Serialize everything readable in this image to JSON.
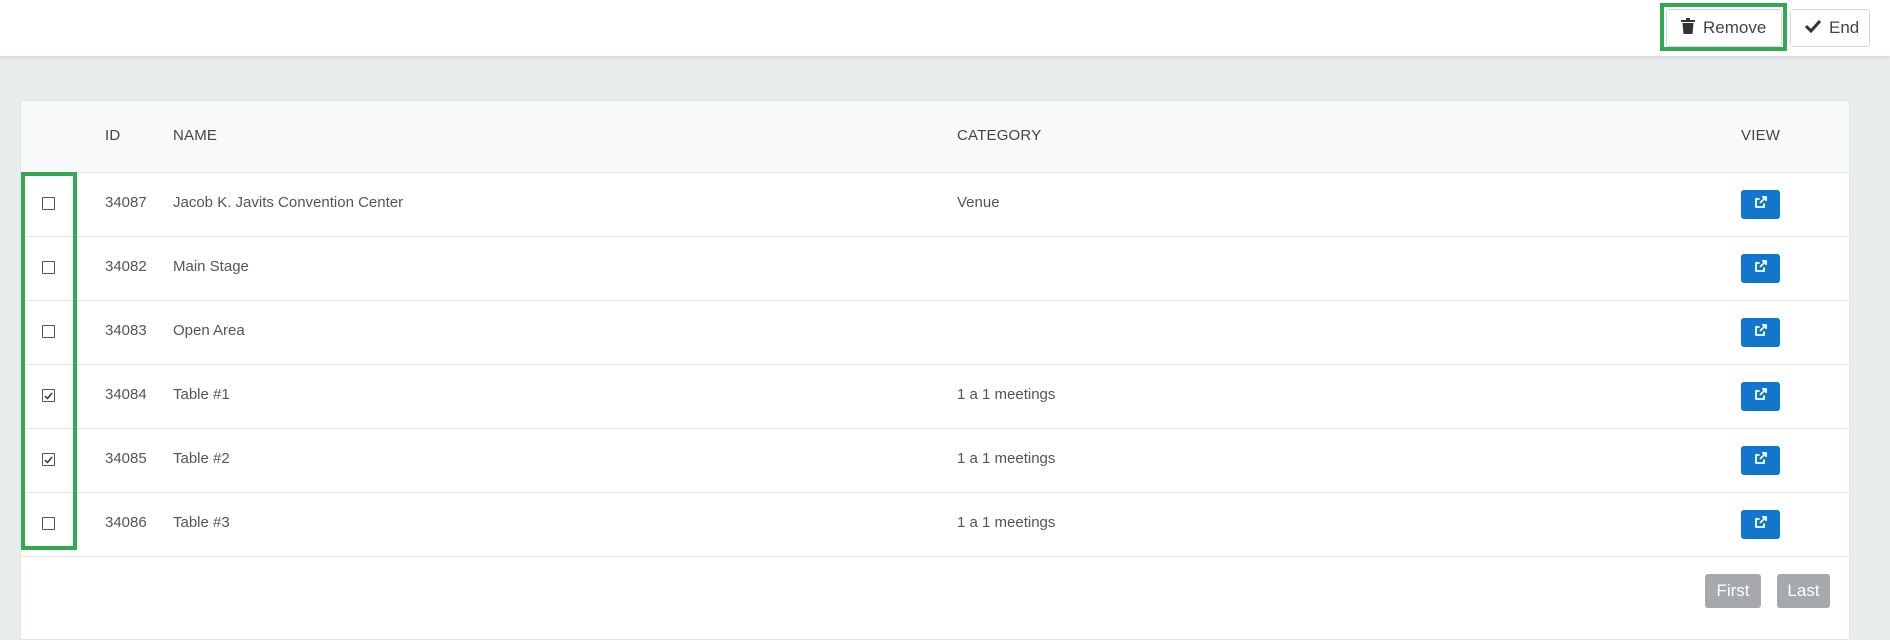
{
  "toolbar": {
    "remove_label": "Remove",
    "end_label": "End"
  },
  "table": {
    "headers": {
      "id": "ID",
      "name": "NAME",
      "category": "CATEGORY",
      "view": "VIEW"
    },
    "rows": [
      {
        "id": "34087",
        "name": "Jacob K. Javits Convention Center",
        "category": "Venue",
        "checked": false
      },
      {
        "id": "34082",
        "name": "Main Stage",
        "category": "",
        "checked": false
      },
      {
        "id": "34083",
        "name": "Open Area",
        "category": "",
        "checked": false
      },
      {
        "id": "34084",
        "name": "Table #1",
        "category": "1 a 1 meetings",
        "checked": true
      },
      {
        "id": "34085",
        "name": "Table #2",
        "category": "1 a 1 meetings",
        "checked": true
      },
      {
        "id": "34086",
        "name": "Table #3",
        "category": "1 a 1 meetings",
        "checked": false
      }
    ]
  },
  "pagination": {
    "first_label": "First",
    "last_label": "Last"
  },
  "colors": {
    "accent": "#1177cc",
    "highlight": "#34a853",
    "pager_disabled": "#a6a9ab"
  },
  "icons": {
    "remove": "trash-icon",
    "end": "check-icon",
    "view": "external-link-icon"
  }
}
